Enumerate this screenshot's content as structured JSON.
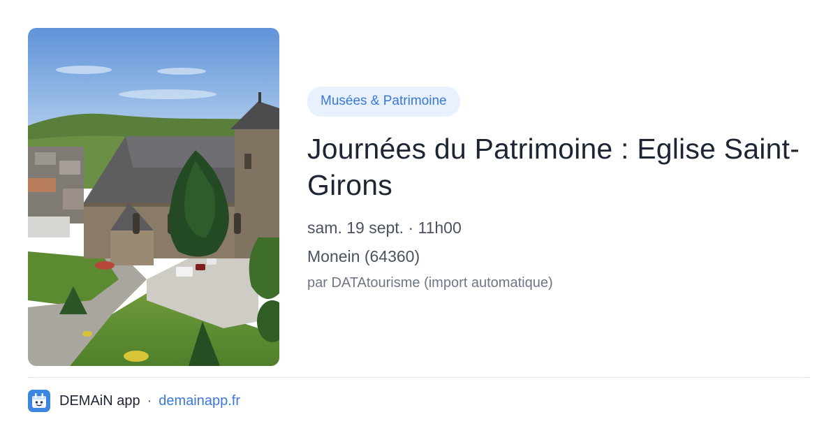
{
  "event": {
    "category": "Musées & Patrimoine",
    "title": "Journées du Patrimoine : Eglise Saint-Girons",
    "date": "sam. 19 sept. · 11h00",
    "location": "Monein (64360)",
    "source": "par DATAtourisme (import automatique)"
  },
  "photo": {
    "subject": "church-photo"
  },
  "footer": {
    "app_name": "DEMAiN app",
    "separator": "·",
    "domain": "demainapp.fr"
  },
  "colors": {
    "accent": "#3a78d8",
    "tag_bg": "#e8f1fd",
    "title": "#1d2433",
    "muted": "#4a5262"
  }
}
